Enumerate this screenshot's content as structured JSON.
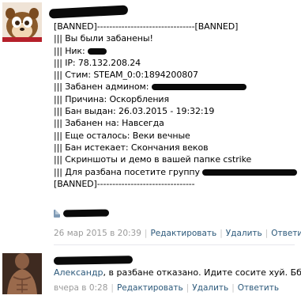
{
  "post": {
    "lines": [
      "[BANNED]--------------------------------[BANNED]",
      "||| Вы были забанены!",
      "||| Ник: ",
      "||| IP: 78.132.208.24",
      "||| Стим: STEAM_0:0:1894200807",
      "||| Забанен админом: ",
      "||| Причина: Оскорбления",
      "||| Бан выдан: 26.03.2015 - 19:32:19",
      "||| Забанен на: Навсегда",
      "||| Еще осталось: Веки вечные",
      "||| Бан истекает: Скончания веков",
      "||| Скриншоты и демо в вашей папке cstrike",
      "||| Для разбана посетите группу ",
      "[BANNED]--------------------------------"
    ],
    "meta": {
      "date": "26 мар 2015 в 20:39",
      "edit": "Редактировать",
      "delete": "Удалить",
      "reply": "Ответить"
    }
  },
  "reply": {
    "name": "Александр",
    "text": ", в разбане отказано. Идите сосите хуй. Бб.",
    "meta": {
      "time": "вчера в 0:28",
      "edit": "Редактировать",
      "delete": "Удалить",
      "reply": "Ответить"
    }
  },
  "colors": {
    "link": "#2b587a",
    "meta": "#9a9a9a",
    "redaction": "#0a0a0a"
  }
}
